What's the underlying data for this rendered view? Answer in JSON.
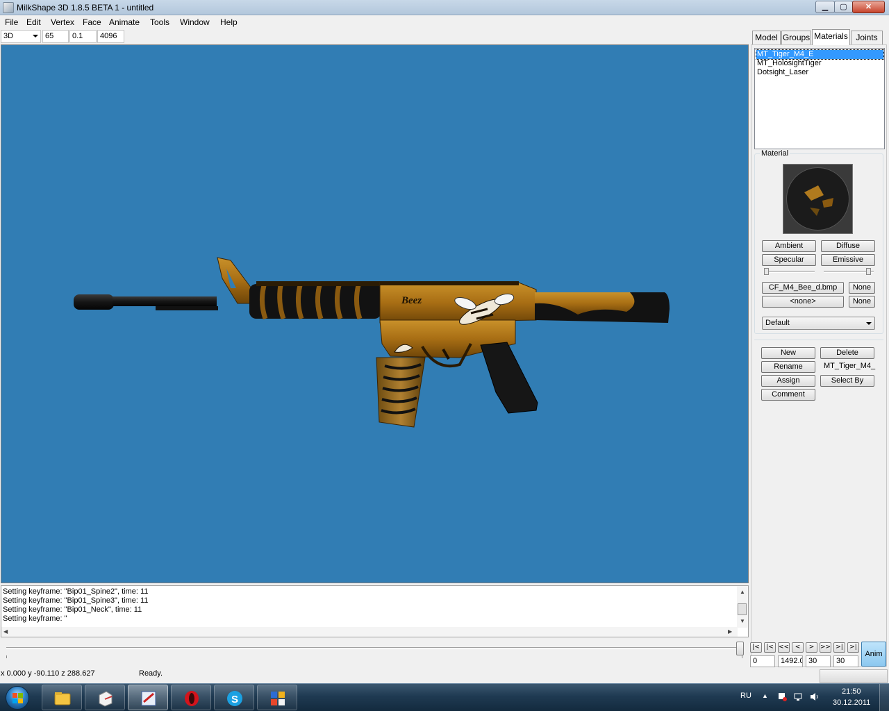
{
  "window": {
    "title": "MilkShape 3D 1.8.5 BETA 1 - untitled",
    "min_glyph": "▁",
    "max_glyph": "▢",
    "close_glyph": "✕"
  },
  "menu": [
    "File",
    "Edit",
    "Vertex",
    "Face",
    "Animate",
    "Tools",
    "Window",
    "Help"
  ],
  "toolbar": {
    "view_mode": "3D",
    "fov": "65",
    "near_clip": "0.1",
    "far_clip": "4096"
  },
  "tabs": [
    "Model",
    "Groups",
    "Materials",
    "Joints"
  ],
  "active_tab": "Materials",
  "materials": {
    "list": [
      "MT_Tiger_M4_E",
      "MT_HolosightTiger",
      "Dotsight_Laser"
    ],
    "selected": "MT_Tiger_M4_E",
    "group_label": "Material",
    "ambient": "Ambient",
    "diffuse": "Diffuse",
    "specular": "Specular",
    "emissive": "Emissive",
    "texture_file": "CF_M4_Bee_d.bmp",
    "texture_clear": "None",
    "alpha_file": "<none>",
    "alpha_clear": "None",
    "shading_mode": "Default",
    "new": "New",
    "delete": "Delete",
    "rename": "Rename",
    "name_value": "MT_Tiger_M4_",
    "assign": "Assign",
    "select_by": "Select By",
    "comment": "Comment"
  },
  "log": [
    "Setting keyframe: \"Bip01_Spine2\", time: 11",
    "Setting keyframe: \"Bip01_Spine3\", time: 11",
    "Setting keyframe: \"Bip01_Neck\", time: 11",
    "Setting keyframe: \""
  ],
  "animation": {
    "buttons": [
      "|<",
      "|<",
      "<<",
      "<",
      ">",
      ">>",
      ">|",
      ">|"
    ],
    "current_frame": "0",
    "frame_value": "1492.0",
    "start_frame": "30",
    "end_frame": "30",
    "anim_label": "Anim",
    "slider_position": 1.0
  },
  "status": {
    "coords": "x 0.000 y -90.110 z 288.627",
    "message": "Ready."
  },
  "viewport": {
    "background": "#317db4",
    "decal_text": "Beez"
  },
  "taskbar": {
    "language": "RU",
    "time": "21:50",
    "date": "30.12.2011",
    "tray_arrow": "▲",
    "apps": [
      "explorer-icon",
      "milkshape-icon",
      "paint-icon",
      "opera-icon",
      "skype-icon",
      "windows-app-icon"
    ]
  }
}
